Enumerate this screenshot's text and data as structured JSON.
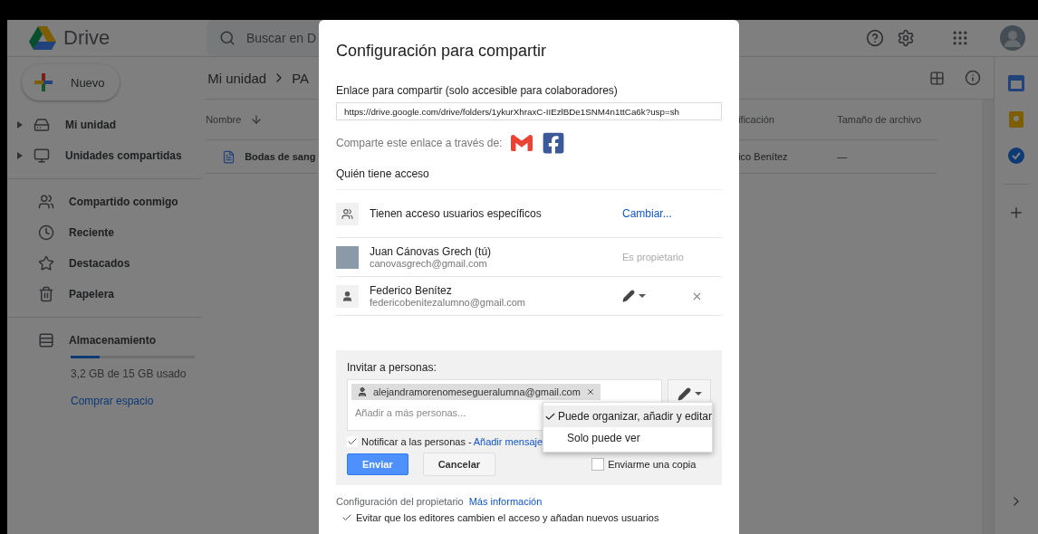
{
  "app": {
    "name": "Drive"
  },
  "search": {
    "placeholder": "Buscar en D"
  },
  "new_button": {
    "label": "Nuevo"
  },
  "sidebar": {
    "items": [
      {
        "label": "Mi unidad",
        "has_children": true
      },
      {
        "label": "Unidades compartidas",
        "has_children": true
      },
      {
        "label": "Compartido conmigo",
        "has_children": false
      },
      {
        "label": "Reciente",
        "has_children": false
      },
      {
        "label": "Destacados",
        "has_children": false
      },
      {
        "label": "Papelera",
        "has_children": false
      }
    ],
    "storage": {
      "label": "Almacenamiento",
      "level": 0.23,
      "usage": "3,2 GB de 15 GB usado",
      "buy_link": "Comprar espacio"
    }
  },
  "breadcrumb": [
    "Mi unidad",
    "PA"
  ],
  "table": {
    "column_1": "Nombre",
    "column_2": "ificación",
    "column_3": "Tamaño de archivo",
    "rows": [
      {
        "name": "Bodas de sang",
        "column_2": "ico Benítez",
        "column_3": "—"
      }
    ]
  },
  "dialog": {
    "title": "Configuración para compartir",
    "link_label": "Enlace para compartir (solo accesible para colaboradores)",
    "link_url": "https://drive.google.com/drive/folders/1ykurXhraxC-IIEzlBDe1SNM4n1ttCa6k?usp=sh",
    "share_via": "Comparte este enlace a través de:",
    "access_heading": "Quién tiene acceso",
    "access": {
      "text": "Tienen acceso usuarios específicos",
      "change_link": "Cambiar..."
    },
    "people": [
      {
        "kind": "owner",
        "name": "Juan Cánovas Grech (tú)",
        "email": "canovasgrech@gmail.com",
        "role": "Es propietario"
      },
      {
        "kind": "editor",
        "name": "Federico Benítez",
        "email": "federicobenitezalumno@gmail.com"
      }
    ],
    "invite": {
      "label": "Invitar a personas:",
      "chips": [
        "alejandramorenomesegueralumna@gmail.com"
      ],
      "placeholder": "Añadir a más personas...",
      "notify": {
        "checked": true,
        "label": "Notificar a las personas - ",
        "link": "Añadir mensaje"
      },
      "send": "Enviar",
      "cancel": "Cancelar",
      "copy": {
        "checked": false,
        "label": "Enviarme una copia"
      }
    },
    "permission_menu": {
      "items": [
        {
          "label": "Puede organizar, añadir y editar",
          "selected": true
        },
        {
          "label": "Solo puede ver",
          "selected": false
        }
      ]
    },
    "owner_settings": {
      "label": "Configuración del propietario",
      "link": "Más información",
      "option": {
        "checked": true,
        "label": "Evitar que los editores cambien el acceso y añadan nuevos usuarios"
      }
    }
  }
}
